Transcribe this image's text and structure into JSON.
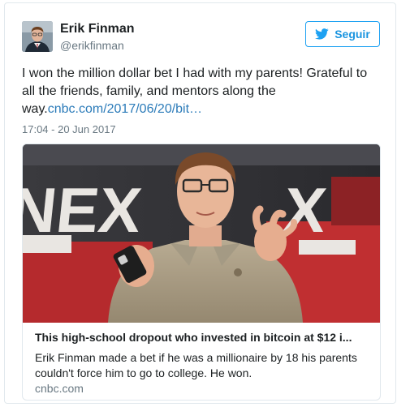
{
  "author": {
    "name": "Erik Finman",
    "handle": "@erikfinman",
    "avatar_icon": "profile-photo"
  },
  "follow_button": {
    "label": "Seguir",
    "icon": "twitter-bird-icon",
    "color": "#1da1f2"
  },
  "tweet": {
    "text": "I won the million dollar bet I had with my parents! Grateful to all the friends, family, and mentors along the way.",
    "link": "cnbc.com/2017/06/20/bit…",
    "timestamp": "17:04 - 20 Jun 2017"
  },
  "link_card": {
    "image_icon": "photo-young-man-gesturing",
    "title": "This high-school dropout who invested in bitcoin at $12 i...",
    "description": "Erik Finman made a bet if he was a millionaire by 18 his parents couldn't force him to go to college. He won.",
    "domain": "cnbc.com"
  },
  "colors": {
    "link": "#2b7bb9",
    "muted_text": "#697882",
    "border": "#e1e8ed"
  }
}
